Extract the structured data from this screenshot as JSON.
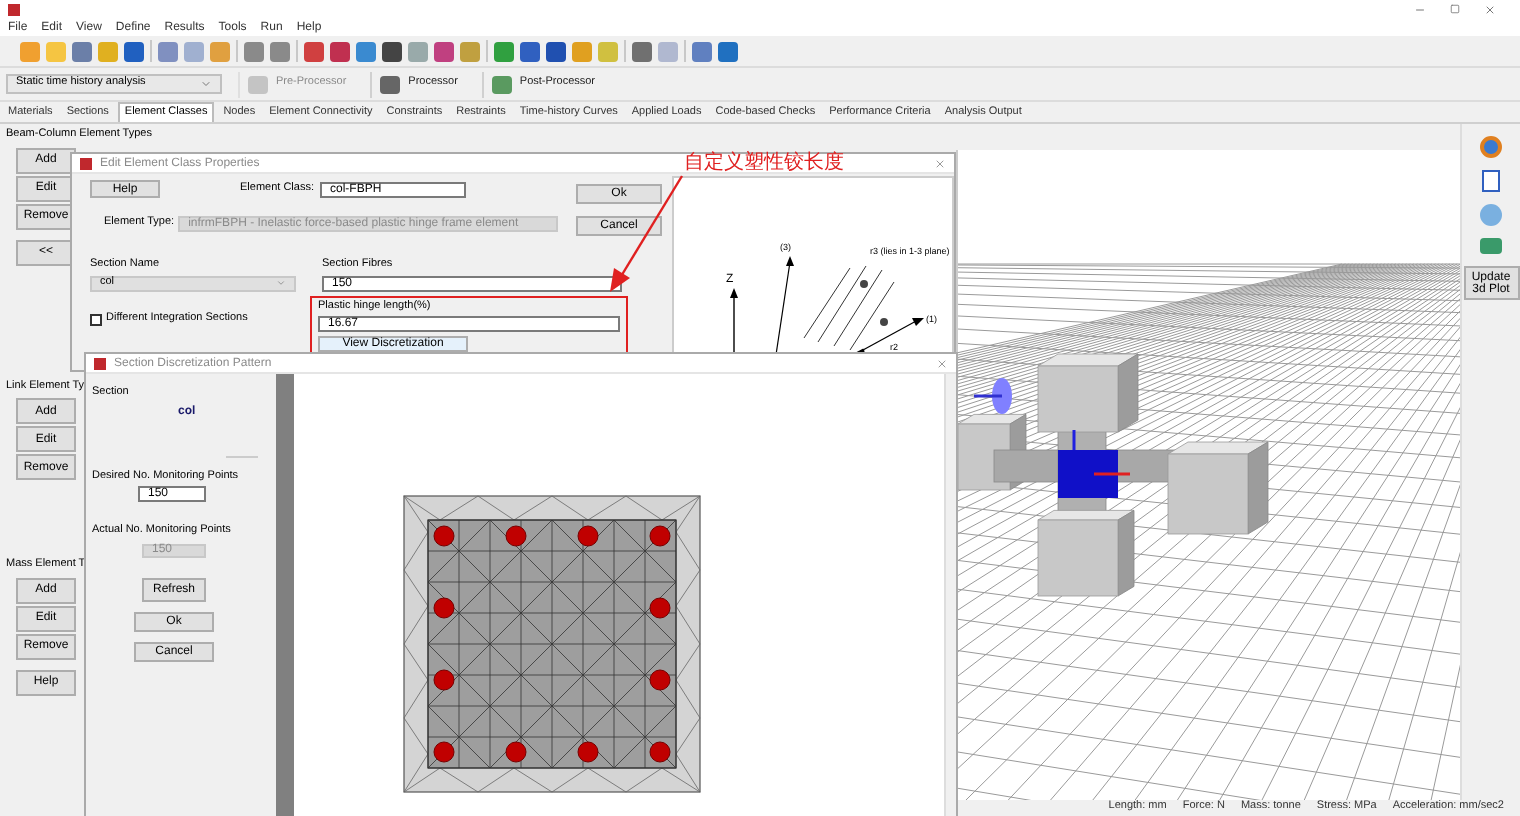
{
  "menu": [
    "File",
    "Edit",
    "View",
    "Define",
    "Results",
    "Tools",
    "Run",
    "Help"
  ],
  "analysis_selector": {
    "value": "Static time history analysis"
  },
  "stage_buttons": [
    {
      "label": "Pre-Processor",
      "disabled": true
    },
    {
      "label": "Processor",
      "disabled": false
    },
    {
      "label": "Post-Processor",
      "disabled": false
    }
  ],
  "tabs": [
    {
      "label": "Materials",
      "selected": false
    },
    {
      "label": "Sections",
      "selected": false
    },
    {
      "label": "Element Classes",
      "selected": true
    },
    {
      "label": "Nodes",
      "selected": false
    },
    {
      "label": "Element Connectivity",
      "selected": false
    },
    {
      "label": "Constraints",
      "selected": false
    },
    {
      "label": "Restraints",
      "selected": false
    },
    {
      "label": "Time-history Curves",
      "selected": false
    },
    {
      "label": "Applied Loads",
      "selected": false
    },
    {
      "label": "Code-based Checks",
      "selected": false
    },
    {
      "label": "Performance Criteria",
      "selected": false
    },
    {
      "label": "Analysis Output",
      "selected": false
    }
  ],
  "left_panel": {
    "groups": [
      {
        "title": "Beam-Column Element Types",
        "buttons": [
          "Add",
          "Edit",
          "Remove",
          "<<"
        ]
      },
      {
        "title": "Link Element Ty",
        "buttons": [
          "Add",
          "Edit",
          "Remove"
        ]
      },
      {
        "title": "Mass Element T",
        "buttons": [
          "Add",
          "Edit",
          "Remove",
          "Help"
        ]
      }
    ]
  },
  "element_class_dialog": {
    "title": "Edit Element Class Properties",
    "help_button": "Help",
    "element_class": {
      "label": "Element Class:",
      "value": "col-FBPH"
    },
    "element_type": {
      "label": "Element Type:",
      "value": "infrmFBPH - Inelastic force-based plastic hinge frame element",
      "disabled": true
    },
    "section_name": {
      "label": "Section Name",
      "value": "col"
    },
    "integration_sections": {
      "label": "Different Integration Sections",
      "checked": false
    },
    "section_fibres": {
      "label": "Section Fibres",
      "value": "150"
    },
    "hinge_length": {
      "label": "Plastic hinge length(%)",
      "value": "16.67"
    },
    "view_button": "View Discretization",
    "buttons": [
      "Ok",
      "Cancel"
    ],
    "axes_labels": [
      "Z",
      "(3)",
      "r3 (lies in 1-3 plane)",
      "(1)",
      "r2"
    ]
  },
  "annotation": {
    "text": "自定义塑性铰长度"
  },
  "discretization_dialog": {
    "title": "Section Discretization Pattern",
    "section_label": "Section",
    "section_value": "col",
    "desired": {
      "label": "Desired No. Monitoring Points",
      "value": "150"
    },
    "actual": {
      "label": "Actual No. Monitoring Points",
      "value": "150",
      "disabled": true
    },
    "refresh_button": "Refresh",
    "buttons": [
      "Ok",
      "Cancel"
    ]
  },
  "viewport": {
    "update_button": "Update 3d Plot"
  },
  "status_bar": [
    "Length: mm",
    "Force: N",
    "Mass: tonne",
    "Stress: MPa",
    "Acceleration: mm/sec2"
  ]
}
